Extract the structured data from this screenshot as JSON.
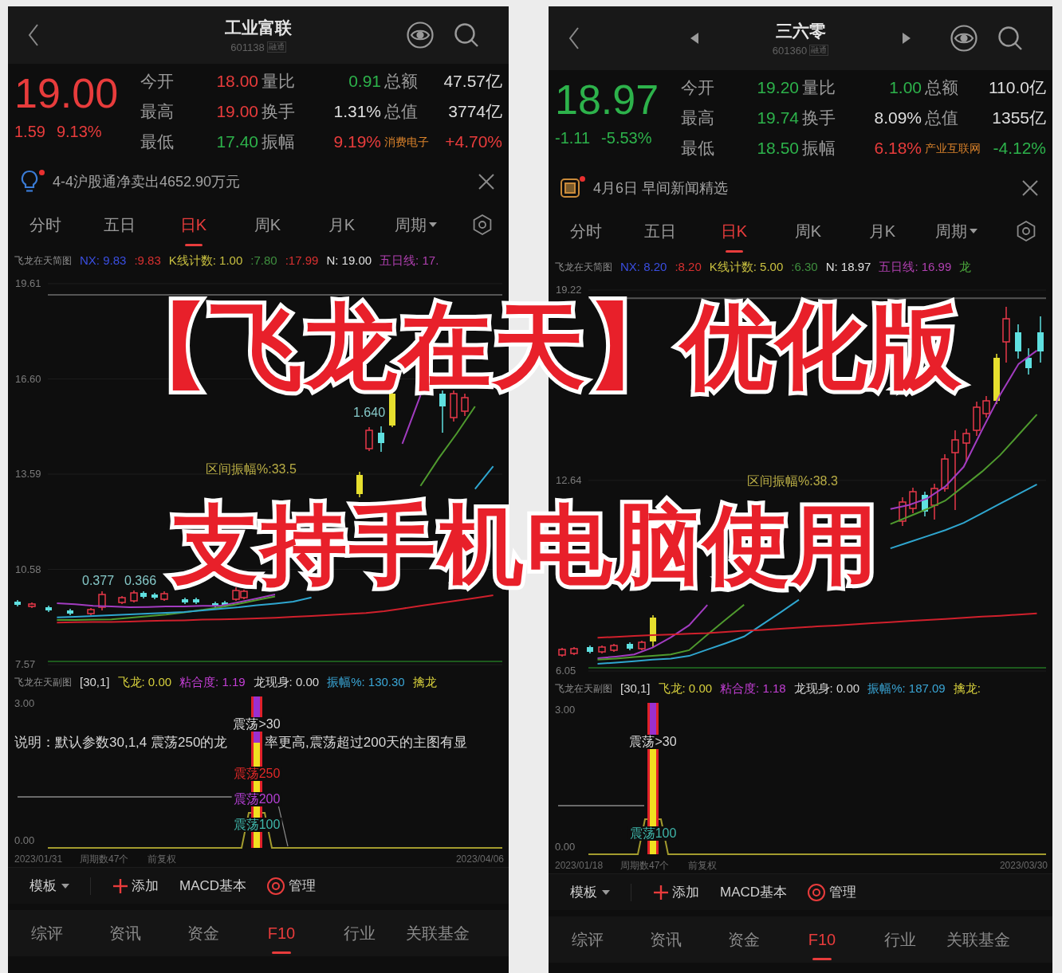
{
  "panels": [
    {
      "header": {
        "title": "工业富联",
        "code": "601138",
        "code_tag": "融通",
        "nav_arrows": false
      },
      "quote": {
        "price": "19.00",
        "change": "1.59",
        "change_pct": "9.13%",
        "color": "#e83c3c",
        "stats": [
          {
            "kind": "stat",
            "label": "今开",
            "value": "18.00",
            "color": "#e83c3c"
          },
          {
            "kind": "stat",
            "label": "量比",
            "value": "0.91",
            "color": "#2db24b"
          },
          {
            "kind": "stat",
            "label": "总额",
            "value": "47.57亿",
            "color": "#dedede"
          },
          {
            "kind": "stat",
            "label": "最高",
            "value": "19.00",
            "color": "#e83c3c"
          },
          {
            "kind": "stat",
            "label": "换手",
            "value": "1.31%",
            "color": "#dedede"
          },
          {
            "kind": "stat",
            "label": "总值",
            "value": "3774亿",
            "color": "#dedede"
          },
          {
            "kind": "stat",
            "label": "最低",
            "value": "17.40",
            "color": "#2db24b"
          },
          {
            "kind": "stat",
            "label": "振幅",
            "value": "9.19%",
            "color": "#e83c3c"
          },
          {
            "kind": "sector",
            "label": "消费电子",
            "value": "+4.70%",
            "color": "#e83c3c"
          }
        ]
      },
      "news": {
        "kind": "tip",
        "text": "4-4沪股通净卖出4652.90万元",
        "unread": true
      },
      "chart_tabs": [
        {
          "label": "分时",
          "selected": false,
          "kind": "tab"
        },
        {
          "label": "五日",
          "selected": false,
          "kind": "tab"
        },
        {
          "label": "日K",
          "selected": true,
          "kind": "tab"
        },
        {
          "label": "周K",
          "selected": false,
          "kind": "tab"
        },
        {
          "label": "月K",
          "selected": false,
          "kind": "tab"
        },
        {
          "label": "周期",
          "selected": false,
          "kind": "dropdown"
        }
      ],
      "main_legend": [
        {
          "text": "飞龙在天简图",
          "color": "#8c8c8c"
        },
        {
          "text": "NX: 9.83",
          "color": "#3a4ee0"
        },
        {
          "text": ":9.83",
          "color": "#d83030"
        },
        {
          "text": "K线计数: 1.00",
          "color": "#c9c040"
        },
        {
          "text": ":7.80",
          "color": "#3f8f3f"
        },
        {
          "text": ":17.99",
          "color": "#d83030"
        },
        {
          "text": "N: 19.00",
          "color": "#e0e0e0"
        },
        {
          "text": "五日线: 17.",
          "color": "#b040b0"
        }
      ],
      "main_chart": {
        "chart_data": {
          "type": "line",
          "ylim": [
            7.57,
            19.61
          ],
          "grid": true,
          "yticks": [
            {
              "value": 19.61,
              "label": "19.61"
            },
            {
              "value": 16.6,
              "label": "16.60"
            },
            {
              "value": 13.59,
              "label": "13.59"
            },
            {
              "value": 10.58,
              "label": "10.58"
            },
            {
              "value": 7.57,
              "label": "7.57"
            }
          ],
          "ref_lines": [
            {
              "axis": "y",
              "value": 19.26,
              "color": "#555555"
            },
            {
              "axis": "y",
              "value": 7.67,
              "color": "#1d5a1d"
            }
          ],
          "series": [
            {
              "color": "#a23cc0",
              "values": [
                9.51,
                9.48,
                9.43,
                9.41,
                9.38,
                9.39,
                9.41,
                9.41,
                9.43,
                9.43,
                9.54,
                9.66,
                9.79,
                null,
                null,
                null,
                null,
                null,
                null,
                14.55,
                16.08,
                null,
                null,
                null,
                null
              ]
            },
            {
              "color": "#4f9a2e",
              "values": [
                8.98,
                8.98,
                8.99,
                9.0,
                9.05,
                9.1,
                9.15,
                9.22,
                9.3,
                9.38,
                9.49,
                9.61,
                9.72,
                null,
                null,
                null,
                null,
                null,
                null,
                null,
                13.22,
                14.09,
                14.88,
                15.73,
                null
              ]
            },
            {
              "color": "#2fa6cf",
              "values": [
                9.06,
                9.08,
                9.11,
                9.13,
                9.16,
                9.18,
                9.21,
                9.23,
                9.28,
                9.33,
                9.38,
                9.45,
                9.5,
                9.56,
                9.69,
                null,
                null,
                null,
                null,
                null,
                null,
                null,
                null,
                13.12,
                13.84
              ]
            },
            {
              "color": "#d0202c",
              "values": [
                8.9,
                8.91,
                8.92,
                8.92,
                8.93,
                8.95,
                8.96,
                8.97,
                8.99,
                9.0,
                9.01,
                9.03,
                9.05,
                9.08,
                9.11,
                9.14,
                9.17,
                9.2,
                9.26,
                9.34,
                9.43,
                9.51,
                9.59,
                9.67,
                9.76
              ]
            }
          ]
        },
        "annotations": [
          {
            "text": "1.640",
            "color": "#86c9c9"
          },
          {
            "text": "区间振幅%:33.5",
            "color": "#b9ad45"
          },
          {
            "text": "0.377",
            "color": "#86c9c9"
          },
          {
            "text": "0.366",
            "color": "#86c9c9"
          }
        ]
      },
      "sub_legend": [
        {
          "text": "飞龙在天副图",
          "color": "#8c8c8c"
        },
        {
          "text": "[30,1]",
          "color": "#d8d8d8"
        },
        {
          "text": "飞龙: 0.00",
          "color": "#d6cf3c"
        },
        {
          "text": "粘合度: 1.19",
          "color": "#c43fd6"
        },
        {
          "text": "龙现身: 0.00",
          "color": "#d8d8d8"
        },
        {
          "text": "振幅%: 130.30",
          "color": "#3aa6d6"
        },
        {
          "text": "擒龙",
          "color": "#d6cf3c"
        }
      ],
      "sub_chart": {
        "y_labels": [
          "3.00",
          "0.00"
        ],
        "note": [
          "说明：默认参数30,1,4 震荡250的龙",
          "率更高,震荡超过200天的主图有显"
        ],
        "levels": [
          {
            "text": "震荡>30",
            "color": "#d8d8d8"
          },
          {
            "text": "震荡250",
            "color": "#e02828"
          },
          {
            "text": "震荡200",
            "color": "#b440d4"
          },
          {
            "text": "震荡100",
            "color": "#3fb6aa"
          }
        ]
      },
      "x_axis": {
        "start": "2023/01/31",
        "period_count": "周期数47个",
        "adjustment": "前复权",
        "end": "2023/04/06"
      },
      "toolbar": {
        "template": "模板",
        "items": [
          {
            "kind": "add",
            "label": "添加"
          },
          {
            "kind": "plain",
            "label": "MACD基本"
          },
          {
            "kind": "manage",
            "label": "管理"
          }
        ]
      },
      "bottom_tabs": [
        {
          "label": "综评",
          "selected": false
        },
        {
          "label": "资讯",
          "selected": false
        },
        {
          "label": "资金",
          "selected": false
        },
        {
          "label": "F10",
          "selected": true
        },
        {
          "label": "行业",
          "selected": false
        },
        {
          "label": "关联基金",
          "selected": false
        }
      ]
    },
    {
      "header": {
        "title": "三六零",
        "code": "601360",
        "code_tag": "融通",
        "nav_arrows": true
      },
      "quote": {
        "price": "18.97",
        "change": "-1.11",
        "change_pct": "-5.53%",
        "color": "#2db24b",
        "stats": [
          {
            "kind": "stat",
            "label": "今开",
            "value": "19.20",
            "color": "#2db24b"
          },
          {
            "kind": "stat",
            "label": "量比",
            "value": "1.00",
            "color": "#2db24b"
          },
          {
            "kind": "stat",
            "label": "总额",
            "value": "110.0亿",
            "color": "#dedede"
          },
          {
            "kind": "stat",
            "label": "最高",
            "value": "19.74",
            "color": "#2db24b"
          },
          {
            "kind": "stat",
            "label": "换手",
            "value": "8.09%",
            "color": "#dedede"
          },
          {
            "kind": "stat",
            "label": "总值",
            "value": "1355亿",
            "color": "#dedede"
          },
          {
            "kind": "stat",
            "label": "最低",
            "value": "18.50",
            "color": "#2db24b"
          },
          {
            "kind": "stat",
            "label": "振幅",
            "value": "6.18%",
            "color": "#e83c3c"
          },
          {
            "kind": "sector",
            "label": "产业互联网",
            "value": "-4.12%",
            "color": "#2db24b"
          }
        ]
      },
      "news": {
        "kind": "news",
        "text": "4月6日 早间新闻精选",
        "unread": true
      },
      "chart_tabs": [
        {
          "label": "分时",
          "selected": false,
          "kind": "tab"
        },
        {
          "label": "五日",
          "selected": false,
          "kind": "tab"
        },
        {
          "label": "日K",
          "selected": true,
          "kind": "tab"
        },
        {
          "label": "周K",
          "selected": false,
          "kind": "tab"
        },
        {
          "label": "月K",
          "selected": false,
          "kind": "tab"
        },
        {
          "label": "周期",
          "selected": false,
          "kind": "dropdown"
        }
      ],
      "main_legend": [
        {
          "text": "飞龙在天简图",
          "color": "#8c8c8c"
        },
        {
          "text": "NX: 8.20",
          "color": "#3a4ee0"
        },
        {
          "text": ":8.20",
          "color": "#d83030"
        },
        {
          "text": "K线计数: 5.00",
          "color": "#c9c040"
        },
        {
          "text": ":6.30",
          "color": "#3f8f3f"
        },
        {
          "text": "N: 18.97",
          "color": "#e0e0e0"
        },
        {
          "text": "五日线: 16.99",
          "color": "#b040b0"
        },
        {
          "text": "龙",
          "color": "#4caa3c"
        }
      ],
      "main_chart": {
        "chart_data": {
          "type": "line",
          "ylim": [
            6.05,
            19.22
          ],
          "grid": true,
          "yticks": [
            {
              "value": 19.22,
              "label": "19.22"
            },
            {
              "value": 12.64,
              "label": "12.64"
            },
            {
              "value": 6.05,
              "label": "6.05"
            }
          ],
          "ref_lines": [
            {
              "axis": "y",
              "value": 18.94,
              "color": "#555555"
            },
            {
              "axis": "y",
              "value": 6.16,
              "color": "#1d5a1d"
            }
          ],
          "series": [
            {
              "color": "#a23cc0",
              "values": [
                6.49,
                6.55,
                6.62,
                6.86,
                7.21,
                7.63,
                8.33,
                null,
                null,
                null,
                null,
                null,
                null,
                null,
                null,
                null,
                11.65,
                11.79,
                12.01,
                12.43,
                13.11,
                14.38,
                15.61,
                16.67,
                17.13
              ]
            },
            {
              "color": "#4f9a2e",
              "values": [
                6.44,
                6.48,
                6.53,
                6.57,
                6.62,
                6.77,
                7.3,
                7.83,
                8.34,
                null,
                null,
                null,
                null,
                null,
                null,
                null,
                11.13,
                11.39,
                11.65,
                11.94,
                12.44,
                12.94,
                13.52,
                14.22,
                14.92
              ]
            },
            {
              "color": "#2fa6cf",
              "values": [
                6.3,
                6.34,
                6.39,
                6.44,
                6.48,
                6.57,
                6.79,
                7.01,
                7.24,
                7.66,
                8.08,
                8.51,
                null,
                null,
                null,
                null,
                10.29,
                10.5,
                10.71,
                10.92,
                11.17,
                11.5,
                11.84,
                12.17,
                12.5
              ]
            },
            {
              "color": "#d0202c",
              "values": [
                7.2,
                7.23,
                7.26,
                7.29,
                7.31,
                7.34,
                7.36,
                7.4,
                7.44,
                7.47,
                7.51,
                7.55,
                7.59,
                7.62,
                7.66,
                7.7,
                7.74,
                7.78,
                7.81,
                7.85,
                7.89,
                7.93,
                7.96,
                8.0,
                8.04
              ]
            }
          ]
        },
        "annotations": [
          {
            "text": "区间振幅%:38.3",
            "color": "#b9ad45"
          }
        ]
      },
      "sub_legend": [
        {
          "text": "飞龙在天副图",
          "color": "#8c8c8c"
        },
        {
          "text": "[30,1]",
          "color": "#d8d8d8"
        },
        {
          "text": "飞龙: 0.00",
          "color": "#d6cf3c"
        },
        {
          "text": "粘合度: 1.18",
          "color": "#c43fd6"
        },
        {
          "text": "龙现身: 0.00",
          "color": "#d8d8d8"
        },
        {
          "text": "振幅%: 187.09",
          "color": "#3aa6d6"
        },
        {
          "text": "擒龙:",
          "color": "#d6cf3c"
        }
      ],
      "sub_chart": {
        "y_labels": [
          "3.00",
          "0.00"
        ],
        "levels": [
          {
            "text": "震荡>30",
            "color": "#d8d8d8"
          },
          {
            "text": "震荡100",
            "color": "#3fb6aa"
          }
        ]
      },
      "x_axis": {
        "start": "2023/01/18",
        "period_count": "周期数47个",
        "adjustment": "前复权",
        "end": "2023/03/30"
      },
      "toolbar": {
        "template": "模板",
        "items": [
          {
            "kind": "add",
            "label": "添加"
          },
          {
            "kind": "plain",
            "label": "MACD基本"
          },
          {
            "kind": "manage",
            "label": "管理"
          }
        ]
      },
      "bottom_tabs": [
        {
          "label": "综评",
          "selected": false
        },
        {
          "label": "资讯",
          "selected": false
        },
        {
          "label": "资金",
          "selected": false
        },
        {
          "label": "F10",
          "selected": true
        },
        {
          "label": "行业",
          "selected": false
        },
        {
          "label": "关联基金",
          "selected": false
        }
      ]
    }
  ],
  "banner": {
    "title": "【飞龙在天】优化版",
    "subtitle": "支持手机电脑使用"
  }
}
